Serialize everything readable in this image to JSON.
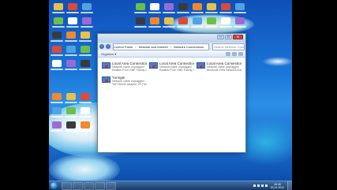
{
  "window": {
    "address_path": [
      "Control Panel",
      "Network and Internet",
      "Network Connections"
    ],
    "search_placeholder": "Search Network Connections",
    "command_bar": {
      "organize_label": "Organize ▾"
    }
  },
  "connections": [
    {
      "name": "Local Area Connection",
      "status": "Network cable unplugged",
      "device": "Realtek PCIe GBE Family Controller",
      "disconnected": true
    },
    {
      "name": "Local Area Connection 2",
      "status": "Network cable unplugged",
      "device": "Realtek PCIe GBE Family Controller",
      "disconnected": true
    },
    {
      "name": "Local Area Connection 3",
      "status": "Network cable unplugged",
      "device": "Bluetooth PAN Network Adapter",
      "disconnected": true
    },
    {
      "name": "Tunngle",
      "status": "Network cable unplugged",
      "device": "TAP-Win32 Adapter V9 (Tunngle)",
      "disconnected": true
    }
  ],
  "taskbar": {
    "time": "16:45",
    "date": "03.01.2011"
  },
  "colors": {
    "wallpaper": "#1a76d8",
    "taskbar": "#183a66",
    "status_disconnected": "#dd1111"
  },
  "icons": {
    "start": "windows-orb",
    "connection": "network-adapter-icon",
    "disconnected": "red-x-icon"
  }
}
